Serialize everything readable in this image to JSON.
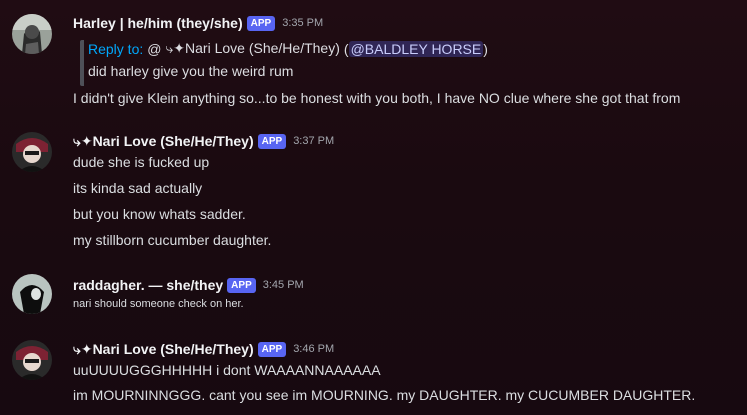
{
  "messages": [
    {
      "author": "Harley | he/him (they/she)",
      "badge": "APP",
      "time": "3:35 PM",
      "reply": {
        "reply_to_label": "Reply to:",
        "at_sign": "@",
        "target": "⤷✦Nari Love (She/He/They)",
        "open_paren": "(",
        "mention": "@BALDLEY HORSE",
        "close_paren": ")",
        "quoted_text": "did harley give you the weird rum"
      },
      "lines": [
        "I didn't give Klein anything so...to be honest with you both, I have NO clue where she got that from"
      ]
    },
    {
      "author": "⤷✦Nari Love (She/He/They)",
      "badge": "APP",
      "time": "3:37 PM",
      "lines": [
        "dude she is fucked up",
        "its kinda sad actually",
        "but you know whats sadder.",
        "my stillborn cucumber daughter."
      ]
    },
    {
      "author": "raddagher. — she/they",
      "badge": "APP",
      "time": "3:45 PM",
      "lines": [
        "nari should someone check on her."
      ]
    },
    {
      "author": "⤷✦Nari Love (She/He/They)",
      "badge": "APP",
      "time": "3:46 PM",
      "lines": [
        "uuUUUUGGGHHHHH i dont WAAAANNAAAAAA",
        "im MOURNINNGGG. cant you see im MOURNING. my DAUGHTER. my CUCUMBER DAUGHTER."
      ]
    }
  ],
  "colors": {
    "background": "#1c0a11",
    "badge": "#5865f2",
    "reply_link": "#00a8fc",
    "mention_bg": "#3b3f7a",
    "text": "#dbdee1",
    "timestamp": "#a3a6ad"
  },
  "icons": [
    "avatar-harley",
    "avatar-nari",
    "avatar-raddagher"
  ]
}
